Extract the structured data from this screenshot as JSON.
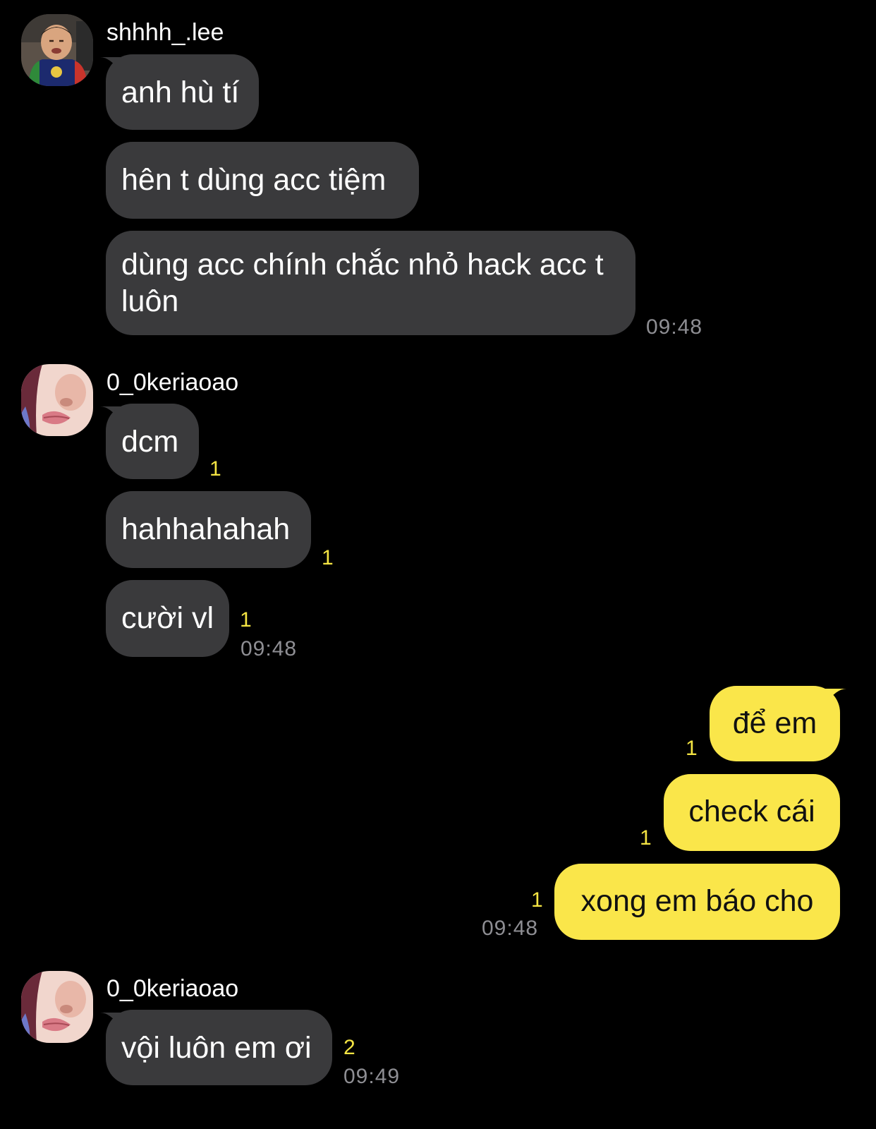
{
  "colors": {
    "background": "#000000",
    "incoming_bubble": "#3a3a3c",
    "outgoing_bubble": "#fae64a",
    "unread_count": "#f4e443",
    "timestamp": "#8e8e93"
  },
  "groups": [
    {
      "sender": "shhhh_.lee",
      "avatar": "avatar-shhhh-lee",
      "messages": [
        {
          "text": "anh hù tí"
        },
        {
          "text": "hên t dùng acc tiệm"
        },
        {
          "text": "dùng acc chính chắc nhỏ hack acc t luôn"
        }
      ],
      "time": "09:48"
    },
    {
      "sender": "0_0keriaoao",
      "avatar": "avatar-0-0keriaoao",
      "messages": [
        {
          "text": "dcm",
          "unread": "1"
        },
        {
          "text": "hahhahahah",
          "unread": "1"
        },
        {
          "text": "cười vl",
          "unread": "1"
        }
      ],
      "time": "09:48"
    },
    {
      "sender": "",
      "outgoing": true,
      "messages": [
        {
          "text": "để em",
          "unread": "1"
        },
        {
          "text": "check cái",
          "unread": "1"
        },
        {
          "text": "xong em báo cho",
          "unread": "1"
        }
      ],
      "time": "09:48"
    },
    {
      "sender": "0_0keriaoao",
      "avatar": "avatar-0-0keriaoao",
      "messages": [
        {
          "text": "vội luôn em ơi",
          "unread": "2"
        }
      ],
      "time": "09:49"
    }
  ]
}
